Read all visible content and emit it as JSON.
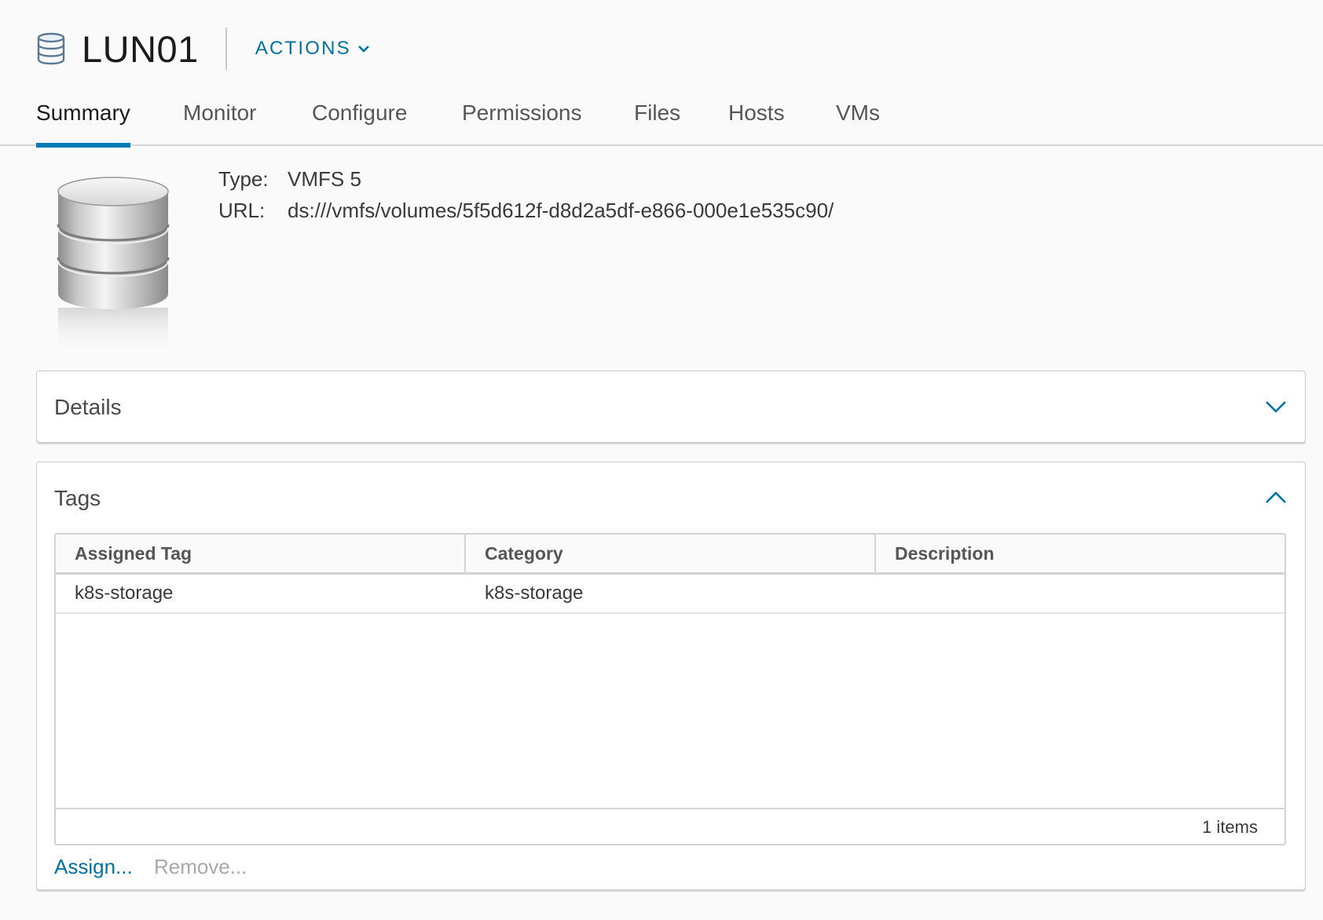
{
  "header": {
    "title": "LUN01",
    "actions_label": "ACTIONS",
    "icon": "datastore-icon"
  },
  "tabs": [
    {
      "label": "Summary",
      "active": true
    },
    {
      "label": "Monitor",
      "active": false
    },
    {
      "label": "Configure",
      "active": false
    },
    {
      "label": "Permissions",
      "active": false
    },
    {
      "label": "Files",
      "active": false
    },
    {
      "label": "Hosts",
      "active": false
    },
    {
      "label": "VMs",
      "active": false
    }
  ],
  "summary": {
    "type_label": "Type:",
    "type_value": "VMFS 5",
    "url_label": "URL:",
    "url_value": "ds:///vmfs/volumes/5f5d612f-d8d2a5df-e866-000e1e535c90/"
  },
  "details_card": {
    "title": "Details",
    "expanded": false
  },
  "tags_card": {
    "title": "Tags",
    "expanded": true,
    "columns": [
      "Assigned Tag",
      "Category",
      "Description"
    ],
    "rows": [
      {
        "tag": "k8s-storage",
        "category": "k8s-storage",
        "description": ""
      }
    ],
    "footer_count": "1 items",
    "assign_label": "Assign...",
    "remove_label": "Remove..."
  },
  "colors": {
    "accent": "#0072a3",
    "tab_underline": "#0079b8",
    "background": "#fafafa",
    "disabled": "#a8a8a8"
  }
}
